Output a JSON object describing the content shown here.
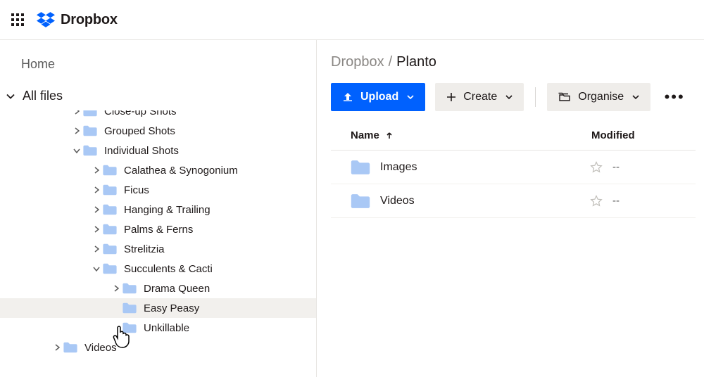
{
  "brand": {
    "name": "Dropbox"
  },
  "sidebar": {
    "home": "Home",
    "all_files": "All files",
    "tree": [
      {
        "label": "Close-up Shots",
        "indent": 100,
        "arrow": "right",
        "clipped": true
      },
      {
        "label": "Grouped Shots",
        "indent": 100,
        "arrow": "right"
      },
      {
        "label": "Individual Shots",
        "indent": 100,
        "arrow": "down"
      },
      {
        "label": "Calathea & Synogonium",
        "indent": 128,
        "arrow": "right"
      },
      {
        "label": "Ficus",
        "indent": 128,
        "arrow": "right"
      },
      {
        "label": "Hanging & Trailing",
        "indent": 128,
        "arrow": "right"
      },
      {
        "label": "Palms & Ferns",
        "indent": 128,
        "arrow": "right"
      },
      {
        "label": "Strelitzia",
        "indent": 128,
        "arrow": "right"
      },
      {
        "label": "Succulents & Cacti",
        "indent": 128,
        "arrow": "down"
      },
      {
        "label": "Drama Queen",
        "indent": 156,
        "arrow": "right"
      },
      {
        "label": "Easy Peasy",
        "indent": 156,
        "arrow": "",
        "hover": true
      },
      {
        "label": "Unkillable",
        "indent": 156,
        "arrow": ""
      },
      {
        "label": "Videos",
        "indent": 72,
        "arrow": "right"
      }
    ]
  },
  "breadcrumb": {
    "root": "Dropbox",
    "sep": "/",
    "leaf": "Planto"
  },
  "toolbar": {
    "upload": "Upload",
    "create": "Create",
    "organise": "Organise"
  },
  "table": {
    "headers": {
      "name": "Name",
      "modified": "Modified"
    },
    "rows": [
      {
        "name": "Images",
        "modified": "--"
      },
      {
        "name": "Videos",
        "modified": "--"
      }
    ]
  }
}
